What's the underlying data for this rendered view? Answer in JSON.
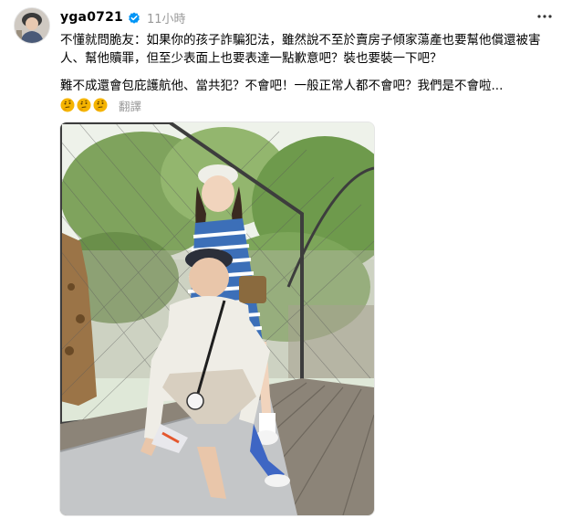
{
  "post": {
    "username": "yga0721",
    "timestamp": "11小時",
    "paragraph_1": "不懂就問脆友：如果你的孩子詐騙犯法，雖然說不至於賣房子傾家蕩產也要幫他償還被害人、幫他贖罪，但至少表面上也要表達一點歉意吧？裝也要裝一下吧？",
    "paragraph_2": "難不成還會包庇護航他、當共犯？不會吧！一般正常人都不會吧？我們是不會啦...",
    "translate_label": "翻譯",
    "emoji_icons": [
      "thinking-face-icon",
      "thinking-face-icon",
      "thinking-face-icon"
    ]
  },
  "colors": {
    "text": "#000000",
    "muted": "#999999",
    "verified_badge": "#0095f6",
    "emoji": "#f5b400"
  },
  "icons": {
    "verified": "verified-badge-icon",
    "more": "more-options-icon"
  }
}
